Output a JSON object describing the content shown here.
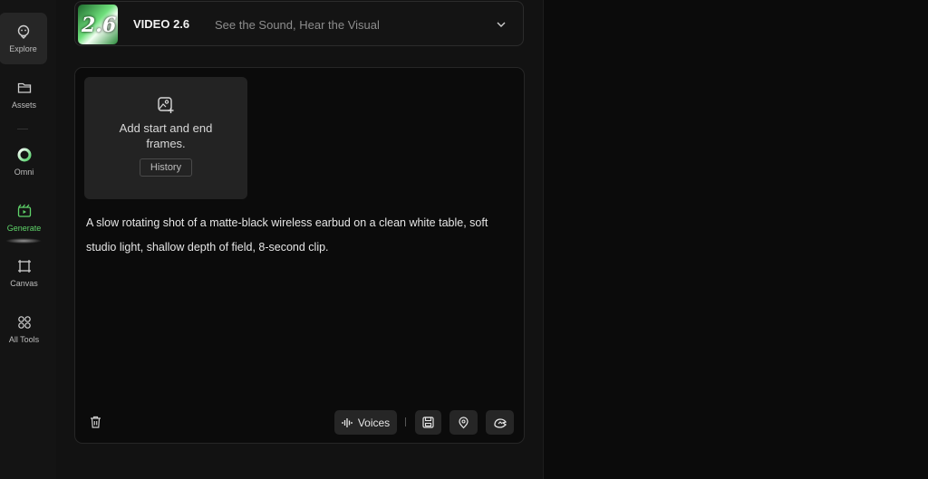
{
  "sidebar": {
    "items": [
      {
        "label": "Explore",
        "icon": "explore-icon"
      },
      {
        "label": "Assets",
        "icon": "folder-icon"
      },
      {
        "label": "Omni",
        "icon": "omni-ring-icon"
      },
      {
        "label": "Generate",
        "icon": "generate-icon"
      },
      {
        "label": "Canvas",
        "icon": "canvas-icon"
      },
      {
        "label": "All Tools",
        "icon": "grid-icon"
      }
    ],
    "active_color": "#5fd46a"
  },
  "model": {
    "thumb_text": "2.6",
    "name": "VIDEO 2.6",
    "tagline": "See the Sound, Hear the Visual"
  },
  "frames": {
    "label": "Add start and end frames.",
    "history_label": "History"
  },
  "prompt": {
    "text": "A slow rotating shot of a matte-black wireless earbud on a clean white table, soft studio light, shallow depth of field, 8-second clip."
  },
  "toolbar": {
    "voices_label": "Voices",
    "icons": [
      "trash-icon",
      "voices-wave-icon",
      "save-icon",
      "location-pin-icon",
      "fast-mode-icon"
    ]
  }
}
